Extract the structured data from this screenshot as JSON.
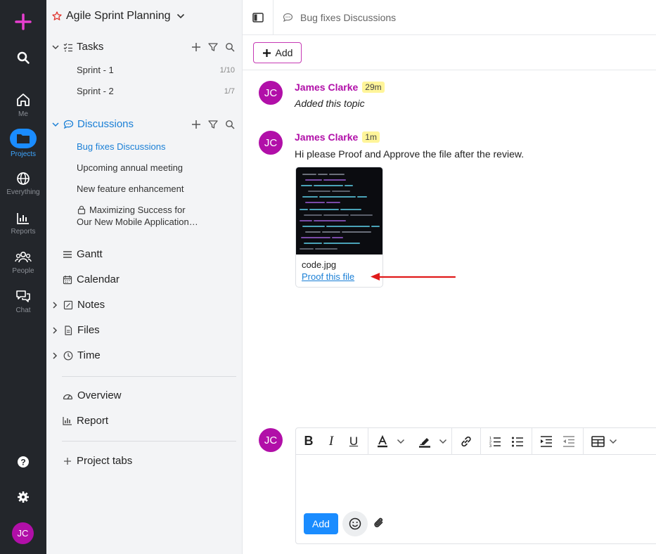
{
  "rail": {
    "items": [
      {
        "label": "Me"
      },
      {
        "label": "Projects"
      },
      {
        "label": "Everything"
      },
      {
        "label": "Reports"
      },
      {
        "label": "People"
      },
      {
        "label": "Chat"
      }
    ],
    "avatar_initials": "JC"
  },
  "sidebar": {
    "project_title": "Agile Sprint Planning",
    "tasks": {
      "label": "Tasks",
      "items": [
        {
          "label": "Sprint - 1",
          "count": "1/10"
        },
        {
          "label": "Sprint - 2",
          "count": "1/7"
        }
      ]
    },
    "discussions": {
      "label": "Discussions",
      "items": [
        {
          "label": "Bug fixes Discussions"
        },
        {
          "label": "Upcoming annual meeting"
        },
        {
          "label": "New feature enhancement"
        },
        {
          "label": "Maximizing Success for",
          "label2": "Our New Mobile Application…"
        }
      ]
    },
    "tools": [
      {
        "label": "Gantt"
      },
      {
        "label": "Calendar"
      },
      {
        "label": "Notes"
      },
      {
        "label": "Files"
      },
      {
        "label": "Time"
      }
    ],
    "views": [
      {
        "label": "Overview"
      },
      {
        "label": "Report"
      }
    ],
    "project_tabs": "Project tabs"
  },
  "main": {
    "breadcrumb": "Bug fixes Discussions",
    "add_label": "Add",
    "messages": [
      {
        "initials": "JC",
        "author": "James Clarke",
        "time": "29m",
        "text": "Added this topic"
      },
      {
        "initials": "JC",
        "author": "James Clarke",
        "time": "1m",
        "text": "Hi please Proof and Approve the file after the review."
      }
    ],
    "attachment": {
      "filename": "code.jpg",
      "action": "Proof this file"
    },
    "composer": {
      "initials": "JC",
      "send_label": "Add"
    }
  },
  "colors": {
    "accent": "#b10fa8",
    "link": "#1a7fd6",
    "active": "#1a8cff",
    "arrow": "#e01b1b"
  }
}
